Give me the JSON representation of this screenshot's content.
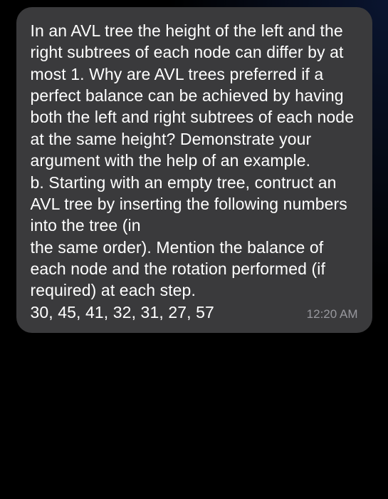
{
  "message": {
    "body": "In an AVL tree the height of the left and the right subtrees of each node can differ by at most 1. Why are AVL trees preferred if a perfect balance can be achieved by having both the left and right subtrees of each node at the same height? Demonstrate your argument with the help of an example.\nb. Starting with an empty tree, contruct an AVL tree by inserting the following numbers into the tree (in\nthe same order). Mention the balance of each node and the rotation performed (if required) at each step.",
    "last_line": "30, 45, 41, 32, 31, 27, 57",
    "timestamp": "12:20 AM"
  }
}
